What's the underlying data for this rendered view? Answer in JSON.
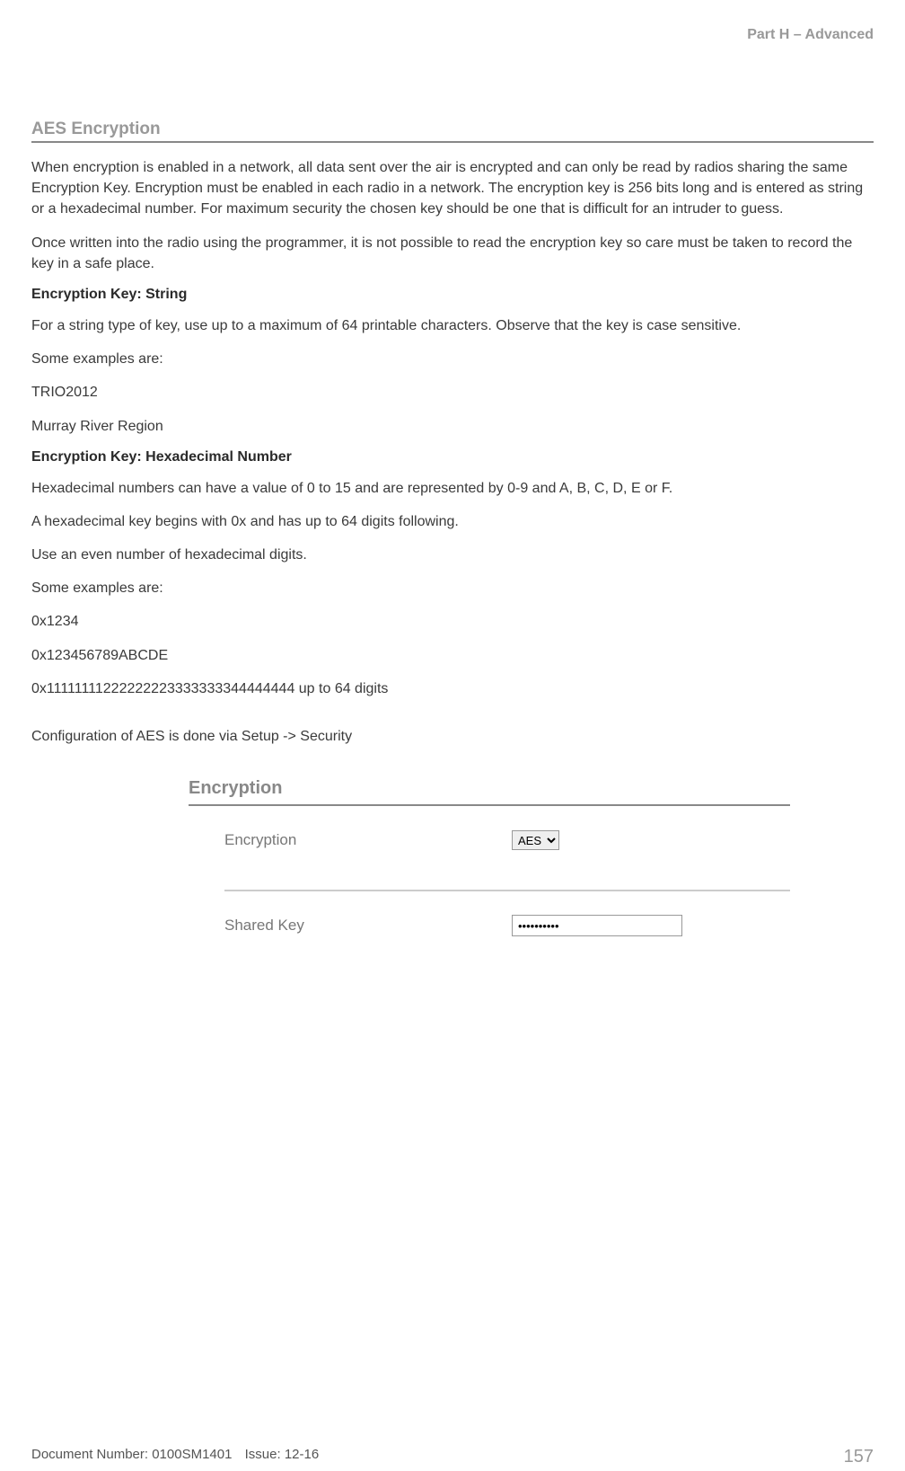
{
  "header": {
    "part": "Part H – Advanced"
  },
  "section": {
    "title": "AES Encryption"
  },
  "paras": {
    "p1": "When encryption is enabled in a network, all data sent over the air is encrypted and can only be read by radios sharing the same Encryption Key. Encryption must be enabled in each radio in a network. The encryption key is 256 bits long and is entered as string or a hexadecimal number. For maximum security the chosen key should be one that is difficult for an intruder to guess.",
    "p2": "Once written into the radio using the programmer, it is not possible to read the encryption key so care must be taken to record the key in a safe place.",
    "h1": "Encryption Key: String",
    "p3": "For a string type of key, use up to a maximum of 64 printable characters. Observe that the key is case sensitive.",
    "p4": "Some examples are:",
    "p5": "TRIO2012",
    "p6": "Murray River Region",
    "h2": "Encryption Key: Hexadecimal Number",
    "p7": "Hexadecimal numbers can have a value of 0 to 15 and are represented by 0-9 and A, B, C, D, E or F.",
    "p8": "A hexadecimal key begins with 0x and has up to 64 digits following.",
    "p9": "Use an even number of hexadecimal digits.",
    "p10": "Some examples are:",
    "p11": "0x1234",
    "p12": "0x123456789ABCDE",
    "p13": "0x11111111222222223333333344444444 up to 64 digits",
    "p14": "Configuration of AES is done via Setup -> Security"
  },
  "panel": {
    "heading": "Encryption",
    "row1_label": "Encryption",
    "row1_value": "AES",
    "row2_label": "Shared Key",
    "row2_value": "••••••••••"
  },
  "footer": {
    "docnum": "Document Number: 0100SM1401",
    "issue": "Issue: 12-16",
    "page": "157"
  }
}
